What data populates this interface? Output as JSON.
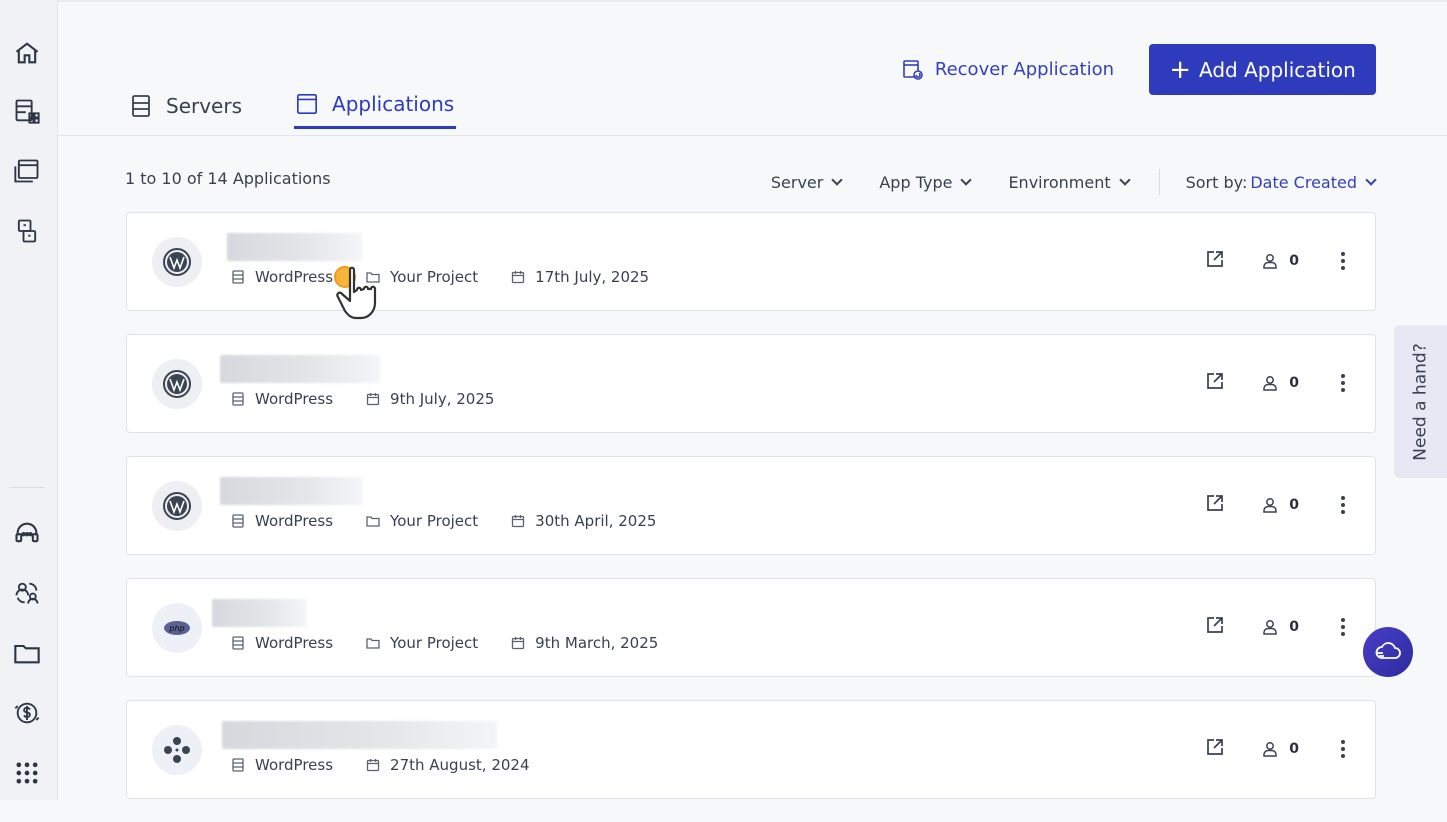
{
  "header": {
    "recover_label": "Recover Application",
    "add_label": "Add Application"
  },
  "tabs": [
    {
      "label": "Servers",
      "active": false
    },
    {
      "label": "Applications",
      "active": true
    }
  ],
  "list": {
    "count_text": "1 to 10 of 14 Applications",
    "filters": {
      "server": "Server",
      "app_type": "App Type",
      "environment": "Environment",
      "sort_label": "Sort by:",
      "sort_value": "Date Created"
    }
  },
  "apps": [
    {
      "type": "WordPress",
      "project": "Your Project",
      "date": "17th July, 2025",
      "users": "0",
      "logo": "wordpress-icon"
    },
    {
      "type": "WordPress",
      "project": "",
      "date": "9th July, 2025",
      "users": "0",
      "logo": "wordpress-icon"
    },
    {
      "type": "WordPress",
      "project": "Your Project",
      "date": "30th April, 2025",
      "users": "0",
      "logo": "wordpress-icon"
    },
    {
      "type": "WordPress",
      "project": "Your Project",
      "date": "9th March, 2025",
      "users": "0",
      "logo": "php-icon"
    },
    {
      "type": "WordPress",
      "project": "",
      "date": "27th August, 2024",
      "users": "0",
      "logo": "wordpress-multisite-icon"
    }
  ],
  "help": {
    "label": "Need a hand?"
  },
  "colors": {
    "accent": "#2f3bbd",
    "sidebar_bg": "#f0f2f5"
  }
}
